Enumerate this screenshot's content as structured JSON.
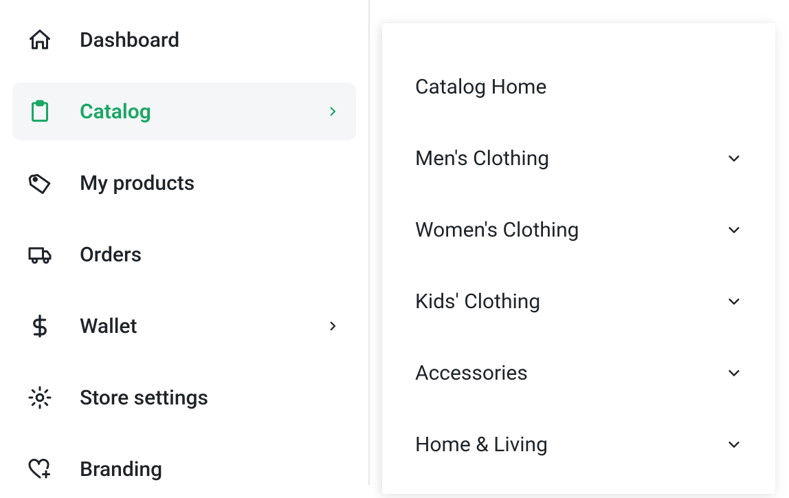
{
  "colors": {
    "accent": "#19a764",
    "text": "#1f2328",
    "activeBg": "#f5f6f7"
  },
  "sidebar": {
    "items": [
      {
        "label": "Dashboard",
        "icon": "home",
        "hasChevron": false,
        "active": false
      },
      {
        "label": "Catalog",
        "icon": "clipboard",
        "hasChevron": true,
        "active": true
      },
      {
        "label": "My products",
        "icon": "tag",
        "hasChevron": false,
        "active": false
      },
      {
        "label": "Orders",
        "icon": "truck",
        "hasChevron": false,
        "active": false
      },
      {
        "label": "Wallet",
        "icon": "dollar",
        "hasChevron": true,
        "active": false
      },
      {
        "label": "Store settings",
        "icon": "gear",
        "hasChevron": false,
        "active": false
      },
      {
        "label": "Branding",
        "icon": "heart-plus",
        "hasChevron": false,
        "active": false
      }
    ]
  },
  "panel": {
    "items": [
      {
        "label": "Catalog Home",
        "hasChevron": false
      },
      {
        "label": "Men's Clothing",
        "hasChevron": true
      },
      {
        "label": "Women's Clothing",
        "hasChevron": true
      },
      {
        "label": "Kids' Clothing",
        "hasChevron": true
      },
      {
        "label": "Accessories",
        "hasChevron": true
      },
      {
        "label": "Home & Living",
        "hasChevron": true
      }
    ]
  }
}
